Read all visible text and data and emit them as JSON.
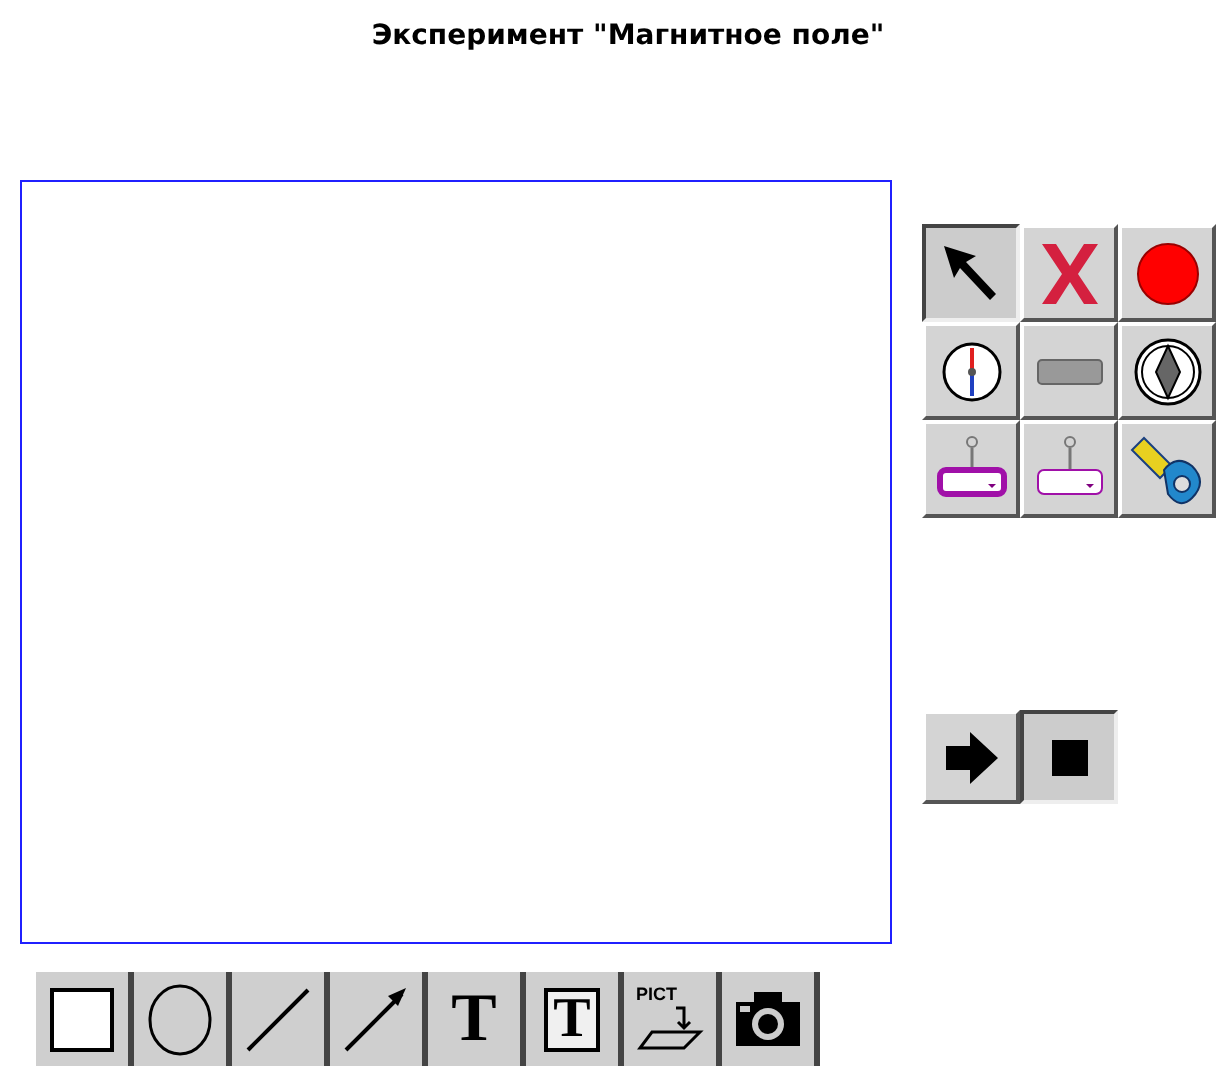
{
  "title": "Эксперимент \"Магнитное поле\"",
  "palette": [
    {
      "kind": "pointer",
      "selected": true
    },
    {
      "kind": "delete",
      "selected": false
    },
    {
      "kind": "dot",
      "selected": false
    },
    {
      "kind": "compass",
      "selected": false
    },
    {
      "kind": "bar",
      "selected": false
    },
    {
      "kind": "needle",
      "selected": false
    },
    {
      "kind": "probe-dark",
      "selected": false
    },
    {
      "kind": "probe-light",
      "selected": false
    },
    {
      "kind": "tape",
      "selected": false
    }
  ],
  "transport": [
    {
      "kind": "play",
      "selected": false
    },
    {
      "kind": "stop",
      "selected": true
    }
  ],
  "tools": [
    {
      "kind": "rect"
    },
    {
      "kind": "ellipse"
    },
    {
      "kind": "line"
    },
    {
      "kind": "arrow"
    },
    {
      "kind": "text",
      "label": "T"
    },
    {
      "kind": "framed-text",
      "label": "T"
    },
    {
      "kind": "pict",
      "label": "PICT"
    },
    {
      "kind": "camera"
    }
  ]
}
